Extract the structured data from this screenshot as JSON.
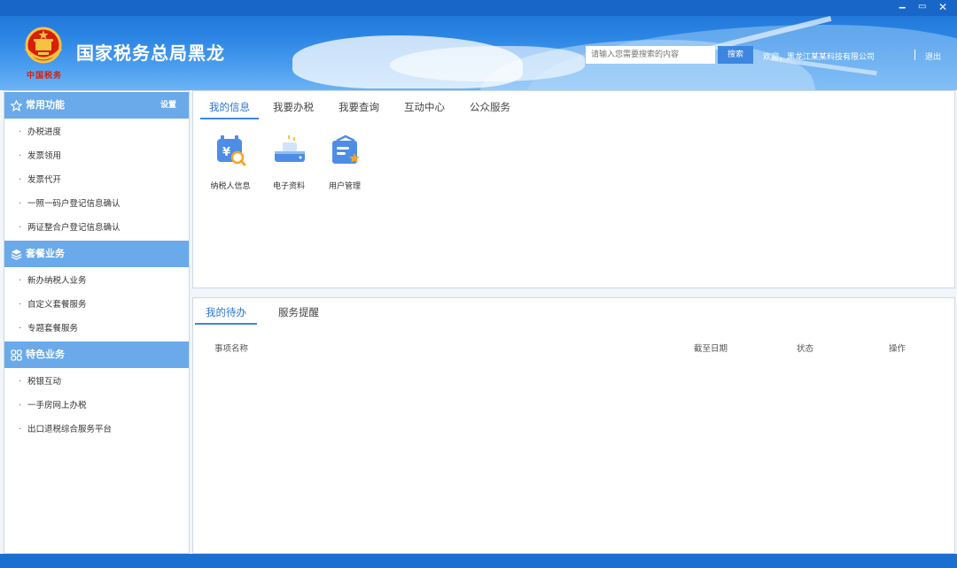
{
  "window": {
    "min": "‒",
    "max": "▭",
    "close": "✕"
  },
  "header": {
    "emblem_text": "中国税务",
    "title": "国家税务总局黑龙",
    "search_placeholder": "请输入您需要搜索的内容",
    "search_button": "搜索",
    "welcome": "欢迎，黑龙江某某科技有限公司",
    "logout": "退出"
  },
  "sidebar": {
    "sections": [
      {
        "title": "常用功能",
        "icon": "star-icon",
        "items": [
          "办税进度",
          "发票领用",
          "发票代开",
          "一照一码户登记信息确认",
          "两证整合户登记信息确认"
        ]
      },
      {
        "title": "套餐业务",
        "icon": "layers-icon",
        "items": [
          "新办纳税人业务",
          "自定义套餐服务",
          "专题套餐服务"
        ]
      },
      {
        "title": "特色业务",
        "icon": "grid-icon",
        "items": [
          "税银互动",
          "一手房网上办税",
          "出口退税综合服务平台"
        ]
      }
    ],
    "settings": "设置",
    "bullet": "·"
  },
  "main": {
    "tabs": [
      "我的信息",
      "我要办税",
      "我要查询",
      "互动中心",
      "公众服务"
    ],
    "tiles": [
      {
        "label": "纳税人信息",
        "icon": "taxpayer-info-icon"
      },
      {
        "label": "电子资料",
        "icon": "electronic-docs-icon"
      },
      {
        "label": "用户管理",
        "icon": "user-management-icon"
      }
    ]
  },
  "todo": {
    "tabs": [
      "我的待办",
      "服务提醒"
    ],
    "columns": [
      "事项名称",
      "截至日期",
      "状态",
      "操作"
    ]
  },
  "colors": {
    "accent": "#3d86e0",
    "section_header": "#6aa9ea",
    "header_blue": "#1a6fd0"
  }
}
